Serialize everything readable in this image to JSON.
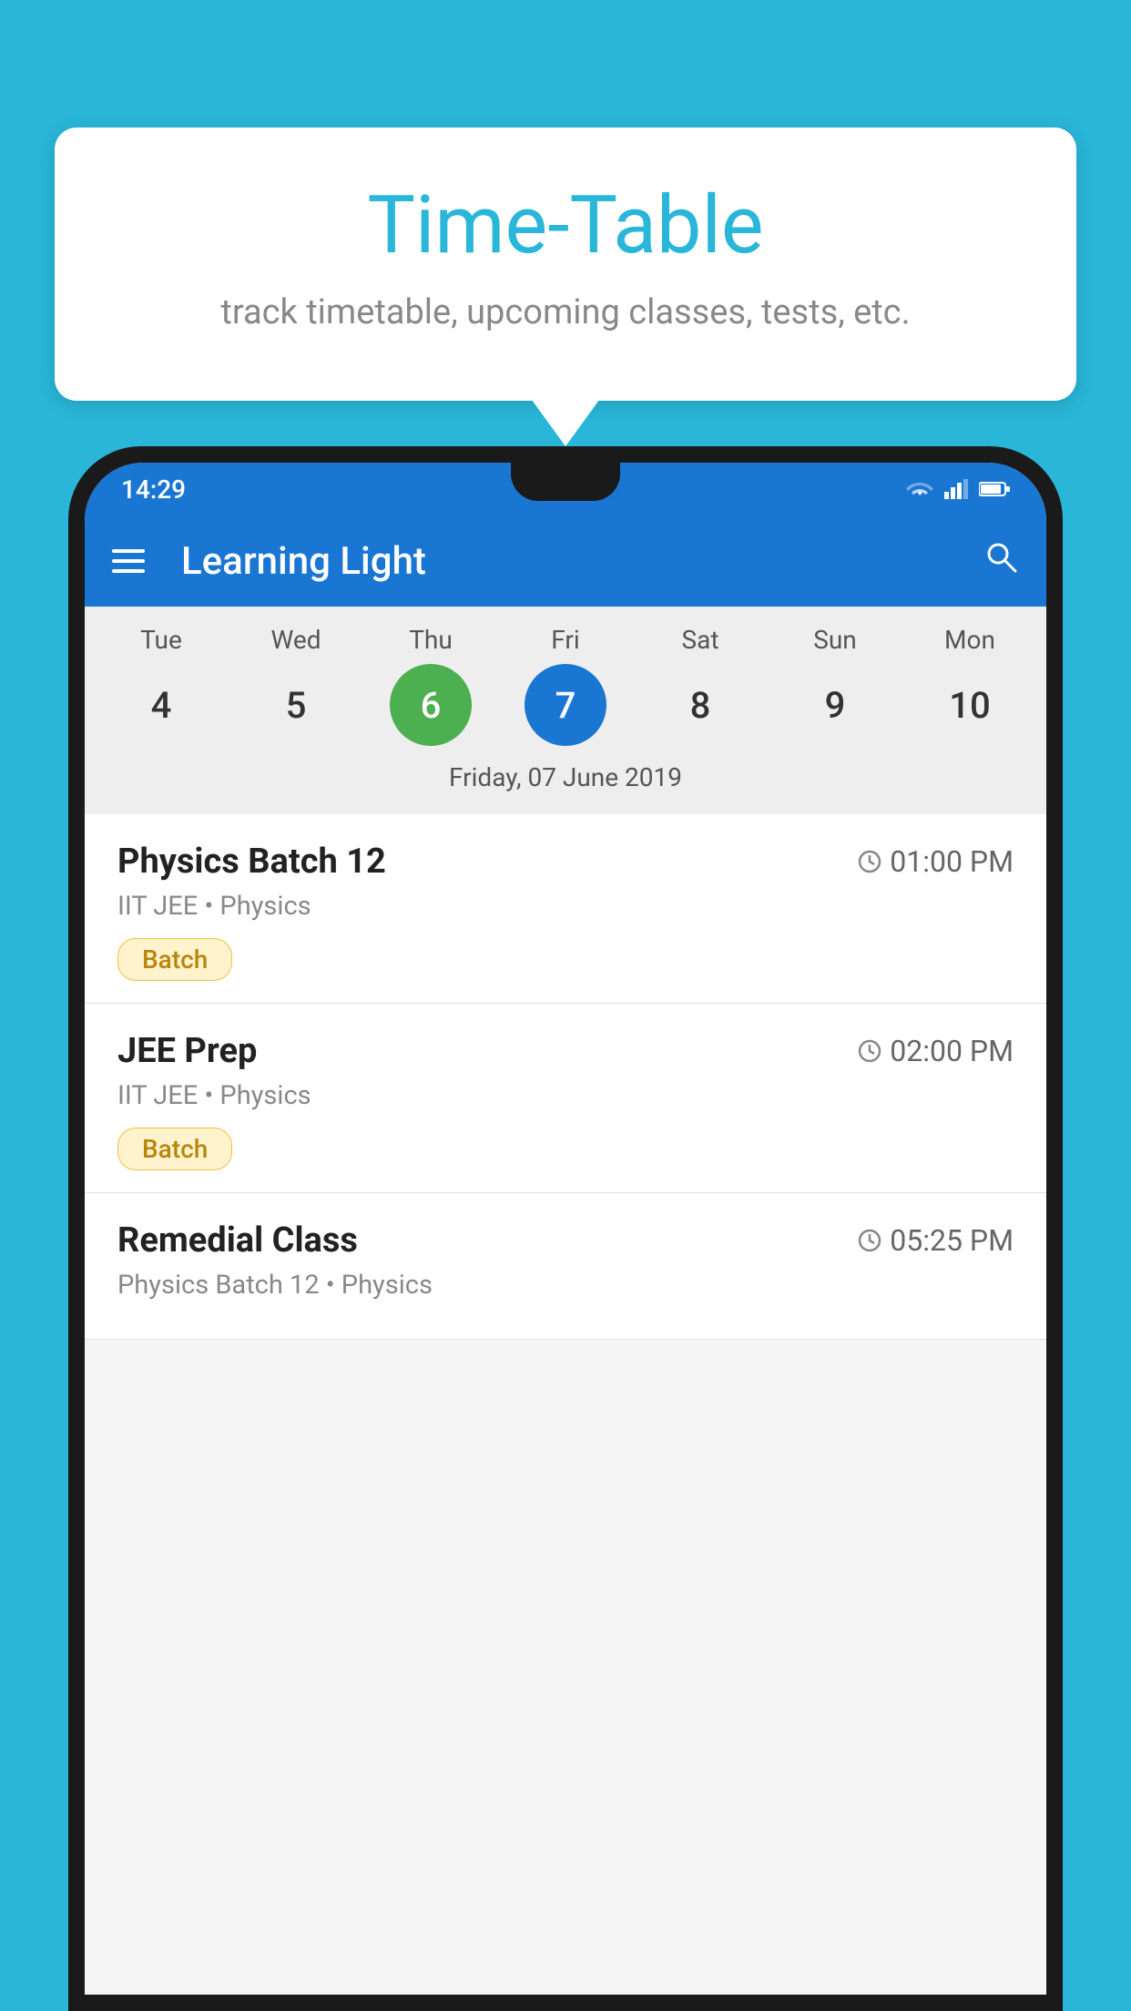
{
  "background_color": "#29B6D8",
  "speech_bubble": {
    "title": "Time-Table",
    "subtitle": "track timetable, upcoming classes, tests, etc."
  },
  "phone": {
    "status_bar": {
      "time": "14:29"
    },
    "app_bar": {
      "title": "Learning Light"
    },
    "calendar": {
      "days": [
        {
          "day": "Tue",
          "num": "4"
        },
        {
          "day": "Wed",
          "num": "5"
        },
        {
          "day": "Thu",
          "num": "6",
          "state": "today"
        },
        {
          "day": "Fri",
          "num": "7",
          "state": "selected"
        },
        {
          "day": "Sat",
          "num": "8"
        },
        {
          "day": "Sun",
          "num": "9"
        },
        {
          "day": "Mon",
          "num": "10"
        }
      ],
      "selected_date_label": "Friday, 07 June 2019"
    },
    "schedule": [
      {
        "title": "Physics Batch 12",
        "time": "01:00 PM",
        "subtitle": "IIT JEE • Physics",
        "badge": "Batch"
      },
      {
        "title": "JEE Prep",
        "time": "02:00 PM",
        "subtitle": "IIT JEE • Physics",
        "badge": "Batch"
      },
      {
        "title": "Remedial Class",
        "time": "05:25 PM",
        "subtitle": "Physics Batch 12 • Physics",
        "badge": null
      }
    ]
  }
}
